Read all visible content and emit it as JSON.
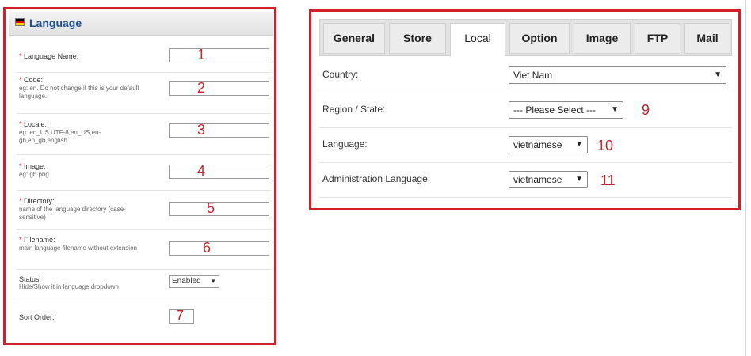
{
  "language_panel": {
    "title": "Language",
    "fields": [
      {
        "label": "Language Name:",
        "help": "",
        "required": true,
        "marker": "1"
      },
      {
        "label": "Code:",
        "help": "eg: en. Do not change if this is your default language.",
        "required": true,
        "marker": "2"
      },
      {
        "label": "Locale:",
        "help": "eg: en_US.UTF-8,en_US,en-gb,en_gb,english",
        "required": true,
        "marker": "3"
      },
      {
        "label": "Image:",
        "help": "eg: gb.png",
        "required": true,
        "marker": "4"
      },
      {
        "label": "Directory:",
        "help": "name of the language directory (case-sensitive)",
        "required": true,
        "marker": "5"
      },
      {
        "label": "Filename:",
        "help": "main language filename without extension",
        "required": true,
        "marker": "6"
      }
    ],
    "status": {
      "label": "Status:",
      "help": "Hide/Show it in language dropdown",
      "value": "Enabled"
    },
    "sort_order": {
      "label": "Sort Order:",
      "marker": "7"
    },
    "required_mark": "*"
  },
  "settings_panel": {
    "tabs": [
      {
        "label": "General"
      },
      {
        "label": "Store"
      },
      {
        "label": "Local",
        "active": true
      },
      {
        "label": "Option"
      },
      {
        "label": "Image"
      },
      {
        "label": "FTP"
      },
      {
        "label": "Mail"
      }
    ],
    "rows": [
      {
        "label": "Country:",
        "value": "Viet Nam",
        "marker": ""
      },
      {
        "label": "Region / State:",
        "value": "--- Please Select ---",
        "marker": "9"
      },
      {
        "label": "Language:",
        "value": "vietnamese",
        "marker": "10"
      },
      {
        "label": "Administration Language:",
        "value": "vietnamese",
        "marker": "11"
      }
    ]
  },
  "colors": {
    "highlight_border": "#d21f2a",
    "marker_text": "#c0282c",
    "title_text": "#1e4f8a"
  },
  "icons": {
    "flag": "german-flag-icon",
    "caret": "chevron-down-icon"
  }
}
